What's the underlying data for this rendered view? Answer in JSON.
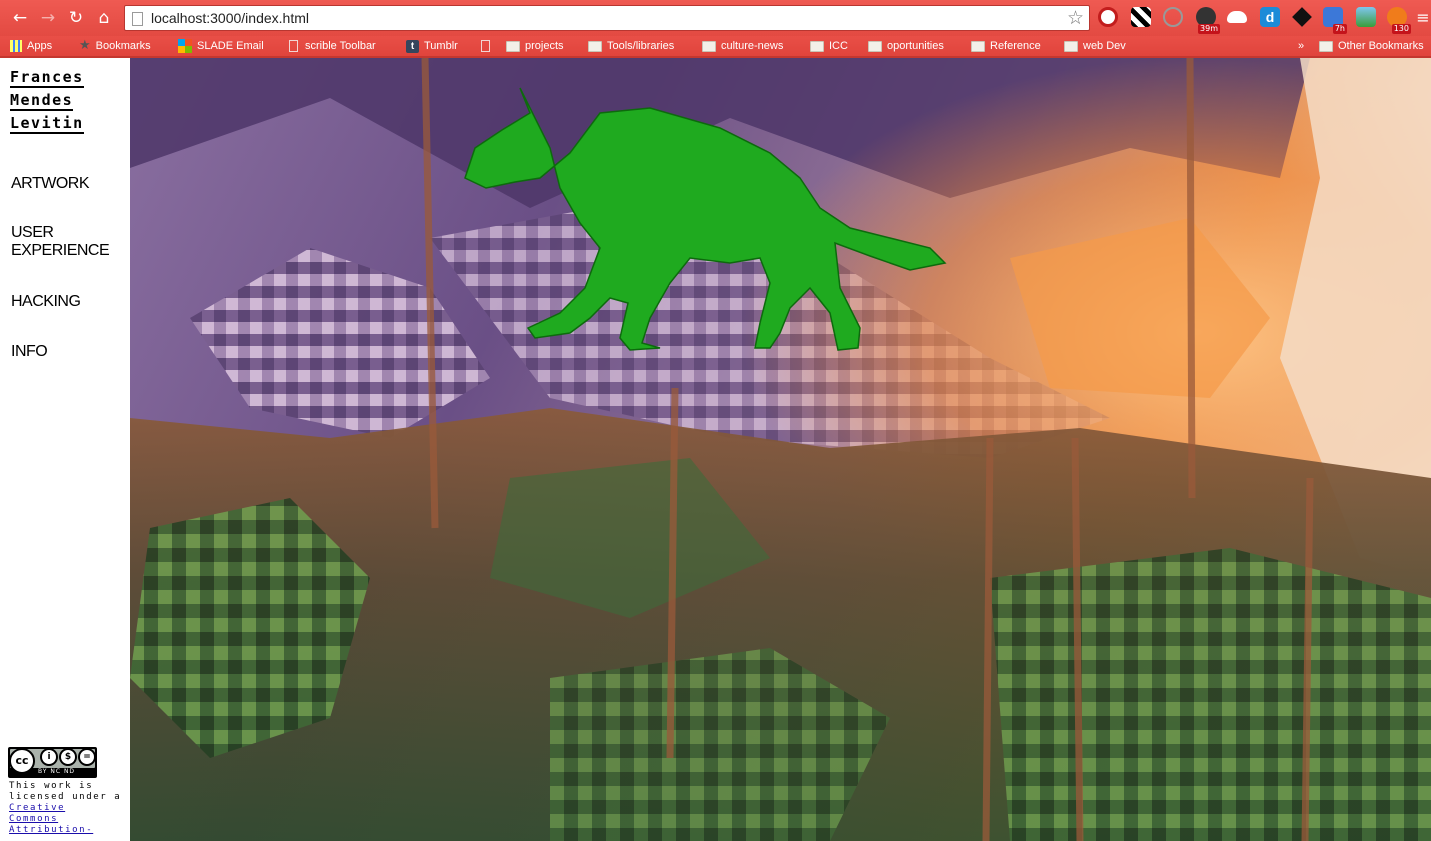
{
  "browser": {
    "url": "localhost:3000/index.html",
    "bookmarks": [
      "Apps",
      "Bookmarks",
      "SLADE Email",
      "scrible Toolbar",
      "Tumblr",
      "",
      "projects",
      "Tools/libraries",
      "culture-news",
      "ICC",
      "oportunities",
      "Reference",
      "web Dev"
    ],
    "overflow_chevron": "»",
    "other_bookmarks": "Other Bookmarks",
    "extension_badges": {
      "timer": "39m",
      "calendar": "7h",
      "feeds": "130"
    }
  },
  "site": {
    "name_lines": [
      "Frances",
      "Mendes",
      "Levitin"
    ],
    "nav": {
      "artwork": "ARTWORK",
      "user_experience_1": "USER",
      "user_experience_2": "EXPERIENCE",
      "hacking": "HACKING",
      "info": "INFO"
    },
    "license": {
      "badge_labels": "BY  NC  ND",
      "line1": "This work is",
      "line2": "licensed under a",
      "link1": "Creative",
      "link2": "Commons",
      "link3": "Attribution-"
    }
  },
  "colors": {
    "chrome_red": "#e8473f",
    "wolf_green": "#1faa1f",
    "sidebar_bg": "#ffffff"
  }
}
